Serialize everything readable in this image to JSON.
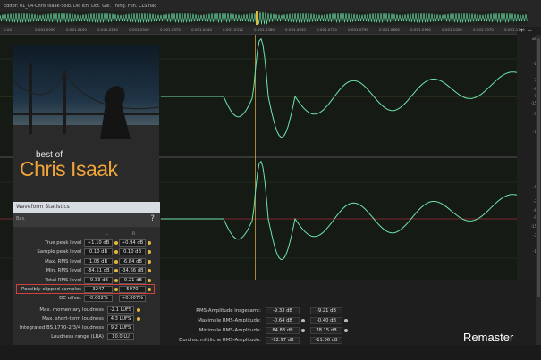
{
  "window": {
    "title": "Editor: 01_04-Chris Isaak-Solo. Dic Ich. Dot. Gel. Thing. Fun. CLS.flac"
  },
  "ruler": {
    "ticks": [
      "0:00",
      "0:001.0090",
      "0:001.0160",
      "0:001.0230",
      "0:001.0300",
      "0:001.0370",
      "0:001.0440",
      "0:001.0510",
      "0:001.0580",
      "0:001.0650",
      "0:001.0720",
      "0:001.0790",
      "0:001.0860",
      "0:001.0930",
      "0:001.1000",
      "0:001.1070",
      "0:001.1140"
    ]
  },
  "scale": {
    "top_channel": [
      "dB",
      "-1",
      "-3",
      "-6",
      "-9",
      "-15",
      "-3",
      "-1"
    ],
    "bottom_channel": [
      "-1",
      "-3",
      "-6",
      "-9",
      "-15",
      "-3",
      "-1"
    ]
  },
  "album": {
    "best_of": "best of",
    "artist": "Chris Isaak"
  },
  "waveform_statistics": {
    "panel_title": "Waveform Statistics",
    "toolbar_label": "Bas.",
    "help": "?",
    "col_l": "L",
    "col_r": "R",
    "rows": [
      {
        "label": "True peak level",
        "l": "+1.10 dB",
        "r": "+0.94 dB"
      },
      {
        "label": "Sample peak level",
        "l": "0.10 dB",
        "r": "0.10 dB"
      },
      {
        "label": "Max. RMS level",
        "l": "1.05 dB",
        "r": "-6.84 dB"
      },
      {
        "label": "Min. RMS level",
        "l": "-84.51 dB",
        "r": "-34.66 dB"
      },
      {
        "label": "Total RMS level",
        "l": "-9.33 dB",
        "r": "-9.21 dB"
      },
      {
        "label": "Possibly clipped samples",
        "l": "3247",
        "r": "5970"
      },
      {
        "label": "DC offset",
        "l": "-0.002%",
        "r": "+0.007%"
      }
    ],
    "loudness": [
      {
        "label": "Max. momentary loudness",
        "value": "-2.1 LUFS"
      },
      {
        "label": "Max. short-term loudness",
        "value": "4.3 LUFS"
      },
      {
        "label": "Integrated BS.1770-2/3/4 loudness",
        "value": "9.2 LUFS"
      },
      {
        "label": "Loudness range (LRA)",
        "value": "10.0 LU"
      }
    ]
  },
  "rms_stats_de": {
    "rows": [
      {
        "label": "RMS-Amplitude insgesamt:",
        "l": "-9.33 dB",
        "r": "-9.21 dB"
      },
      {
        "label": "Maximale RMS-Amplitude:",
        "l": "-0.64 dB",
        "r": "-0.40 dB"
      },
      {
        "label": "Minimale RMS-Amplitude:",
        "l": "84.83 dB",
        "r": "78.15 dB"
      },
      {
        "label": "Durchschnittliche RMS-Amplitude:",
        "l": "-12.97 dB",
        "r": "-11.06 dB"
      }
    ]
  },
  "overlay": {
    "remaster": "Remaster"
  },
  "colors": {
    "waveform": "#6ee4a9",
    "clip_outline": "#d0413d",
    "album_text": "#f0a53a",
    "marker": "#e2b83d",
    "zero_line": "#a02a3a"
  }
}
